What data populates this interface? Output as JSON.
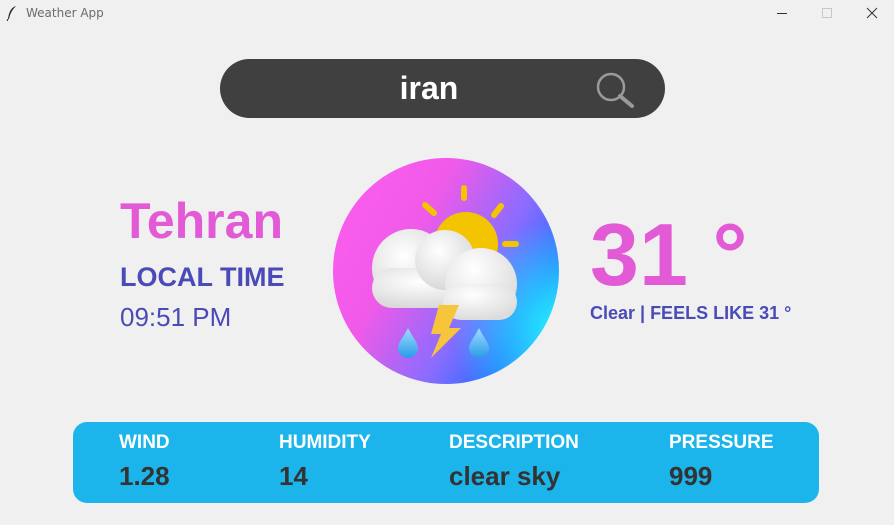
{
  "window": {
    "title": "Weather App",
    "icon": "feather-icon"
  },
  "search": {
    "value": "iran",
    "icon": "search-icon"
  },
  "location": {
    "city": "Tehran",
    "local_time_label": "LOCAL TIME",
    "local_time": "09:51 PM"
  },
  "current": {
    "temperature": "31 °",
    "condition": "Clear | FEELS LIKE 31 °",
    "icon": "thunderstorm-sun-cloud-icon"
  },
  "details": {
    "wind_label": "WIND",
    "wind_value": "1.28",
    "humidity_label": "HUMIDITY",
    "humidity_value": "14",
    "description_label": "DESCRIPTION",
    "description_value": "clear sky",
    "pressure_label": "PRESSURE",
    "pressure_value": "999"
  },
  "colors": {
    "accent_pink": "#e35ad6",
    "accent_indigo": "#4b4bb8",
    "panel_blue": "#1bb5ec",
    "searchbar": "#404040",
    "background": "#f0f0f0"
  }
}
